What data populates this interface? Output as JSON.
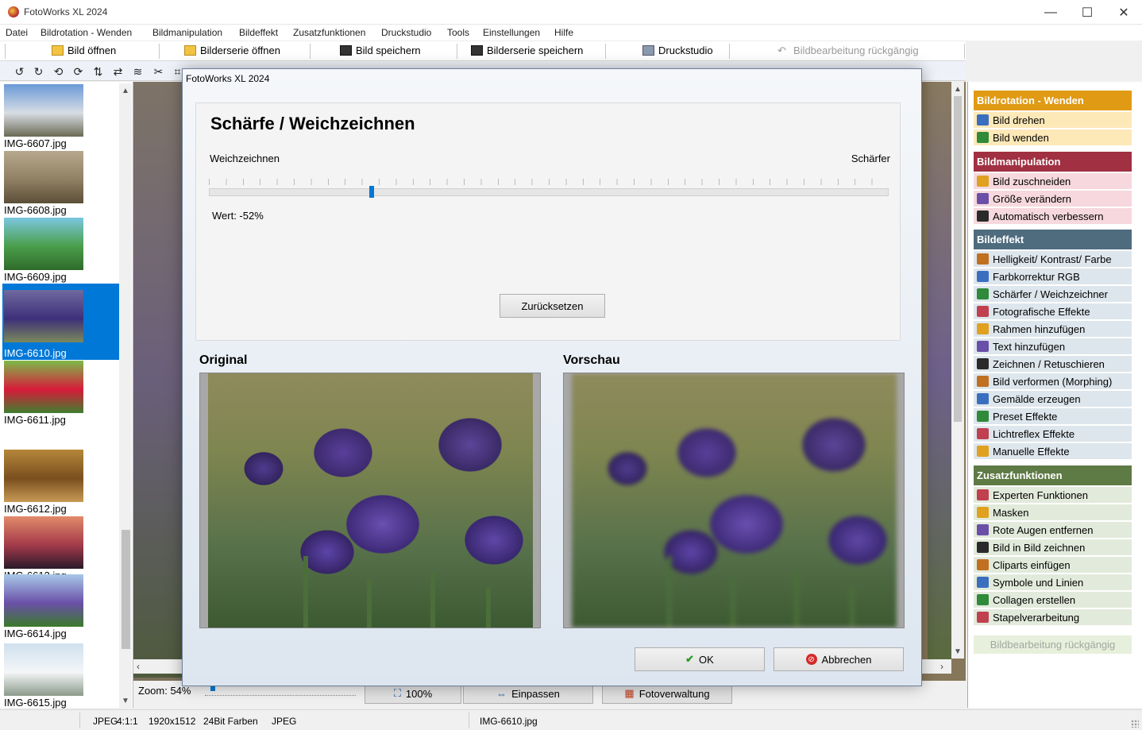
{
  "window": {
    "title": "FotoWorks XL 2024",
    "min": "—",
    "max": "☐",
    "close": "✕"
  },
  "menu": [
    "Datei",
    "Bildrotation - Wenden",
    "Bildmanipulation",
    "Bildeffekt",
    "Zusatzfunktionen",
    "Druckstudio",
    "Tools",
    "Einstellungen",
    "Hilfe"
  ],
  "toolbar": {
    "open_image": "Bild öffnen",
    "open_series": "Bilderserie öffnen",
    "save_image": "Bild speichern",
    "save_series": "Bilderserie speichern",
    "print_studio": "Druckstudio",
    "undo": "Bildbearbeitung rückgängig"
  },
  "thumbnails": [
    {
      "name": "IMG-6607.jpg",
      "colors": [
        "#6a9ad8",
        "#d8dde3",
        "#6b6a55"
      ]
    },
    {
      "name": "IMG-6608.jpg",
      "colors": [
        "#b7a98e",
        "#8f7f63",
        "#5c4e38"
      ]
    },
    {
      "name": "IMG-6609.jpg",
      "colors": [
        "#7cc7e0",
        "#4a9e4a",
        "#2f6b2a"
      ]
    },
    {
      "name": "IMG-6610.jpg",
      "colors": [
        "#6f6a9f",
        "#3d2f7a",
        "#7a8a5a"
      ],
      "selected": true
    },
    {
      "name": "IMG-6611.jpg",
      "colors": [
        "#7dbb4a",
        "#d81b3a",
        "#3f7f2f"
      ]
    },
    {
      "name": "IMG-6612.jpg",
      "colors": [
        "#b5873a",
        "#7a4f1e",
        "#c89a55"
      ]
    },
    {
      "name": "IMG-6613.jpg",
      "colors": [
        "#e28a6a",
        "#a33a4a",
        "#2a1a2a"
      ]
    },
    {
      "name": "IMG-6614.jpg",
      "colors": [
        "#a8c8e8",
        "#6a4fa8",
        "#3a7a2a"
      ]
    },
    {
      "name": "IMG-6615.jpg",
      "colors": [
        "#cfe0ee",
        "#f4f6f8",
        "#8a9a8a"
      ]
    }
  ],
  "zoom": {
    "label": "Zoom: 54%",
    "btn_100": "100%",
    "btn_fit": "Einpassen",
    "btn_manager": "Fotoverwaltung"
  },
  "sidebar": [
    {
      "title": "Bildrotation - Wenden",
      "color": "#e09a14",
      "item_bg": "#fde8b8",
      "items": [
        "Bild drehen",
        "Bild wenden"
      ]
    },
    {
      "title": "Bildmanipulation",
      "color": "#a03042",
      "item_bg": "#f6d8de",
      "items": [
        "Bild zuschneiden",
        "Größe verändern",
        "Automatisch verbessern"
      ]
    },
    {
      "title": "Bildeffekt",
      "color": "#4f6b7e",
      "item_bg": "#dde6ec",
      "items": [
        "Helligkeit/ Kontrast/ Farbe",
        "Farbkorrektur RGB",
        "Schärfer / Weichzeichner",
        "Fotografische Effekte",
        "Rahmen hinzufügen",
        "Text hinzufügen",
        "Zeichnen / Retuschieren",
        "Bild verformen (Morphing)",
        "Gemälde erzeugen",
        "Preset Effekte",
        "Lichtreflex Effekte",
        "Manuelle Effekte"
      ]
    },
    {
      "title": "Zusatzfunktionen",
      "color": "#5e7a45",
      "item_bg": "#e2eadb",
      "items": [
        "Experten Funktionen",
        "Masken",
        "Rote Augen entfernen",
        "Bild in Bild zeichnen",
        "Cliparts einfügen",
        "Symbole und Linien",
        "Collagen erstellen",
        "Stapelverarbeitung"
      ]
    }
  ],
  "sidebar_undo": "Bildbearbeitung rückgängig",
  "status": {
    "format": "JPEG",
    "ratio": "4:1:1",
    "size": "1920x1512",
    "depth": "24Bit Farben",
    "type": "JPEG",
    "file": "IMG-6610.jpg"
  },
  "dialog": {
    "title": "FotoWorks XL 2024",
    "heading": "Schärfe / Weichzeichnen",
    "left_label": "Weichzeichnen",
    "right_label": "Schärfer",
    "slider_value": -52,
    "slider_min": -100,
    "slider_max": 100,
    "value_text": "Wert: -52%",
    "reset": "Zurücksetzen",
    "original": "Original",
    "preview": "Vorschau",
    "ok": "OK",
    "cancel": "Abbrechen"
  }
}
